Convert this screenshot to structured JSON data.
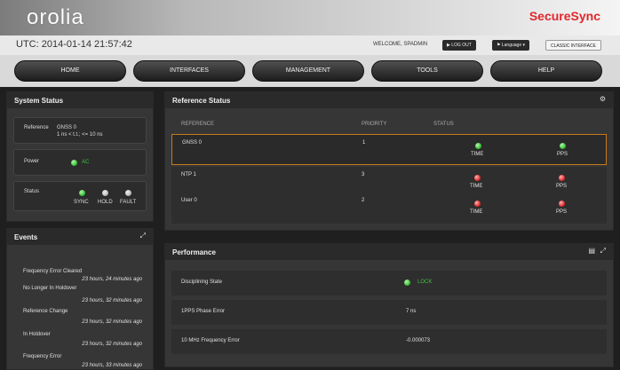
{
  "header": {
    "logo_text": "orolia",
    "product_name": "SecureSync"
  },
  "infobar": {
    "utc": "UTC: 2014-01-14 21:57:42",
    "welcome": "WELCOME, SPADMIN",
    "logout_label": "LOG OUT",
    "language_label": "Language",
    "classic_label": "CLASSIC INTERFACE"
  },
  "nav": {
    "items": [
      "HOME",
      "INTERFACES",
      "MANAGEMENT",
      "TOOLS",
      "HELP"
    ]
  },
  "system_status": {
    "title": "System Status",
    "reference_label": "Reference",
    "reference_value": "GNSS 0",
    "reference_sub": "1 ns < t.t.; <= 10 ns",
    "power_label": "Power",
    "power_value": "AC",
    "status_label": "Status",
    "indicators": [
      "SYNC",
      "HOLD",
      "FAULT"
    ],
    "indicator_states": [
      "green",
      "grey",
      "grey"
    ]
  },
  "events": {
    "title": "Events",
    "expand_icon": "expand-icon",
    "items": [
      {
        "text": "Frequency Error Cleared",
        "time": "23 hours, 24 minutes ago"
      },
      {
        "text": "No Longer In Holdover",
        "time": "23 hours, 32 minutes ago"
      },
      {
        "text": "Reference Change",
        "time": "23 hours, 32 minutes ago"
      },
      {
        "text": "In Holdover",
        "time": "23 hours, 32 minutes ago"
      },
      {
        "text": "Frequency Error",
        "time": "23 hours, 33 minutes ago"
      }
    ]
  },
  "reference_status": {
    "title": "Reference Status",
    "settings_icon": "gear-icon",
    "columns": [
      "REFERENCE",
      "PRIORITY",
      "STATUS"
    ],
    "time_label": "TIME",
    "pps_label": "PPS",
    "rows": [
      {
        "name": "GNSS 0",
        "priority": "1",
        "time": "green",
        "pps": "green"
      },
      {
        "name": "NTP 1",
        "priority": "3",
        "time": "red",
        "pps": "red"
      },
      {
        "name": "User 0",
        "priority": "2",
        "time": "red",
        "pps": "red"
      }
    ]
  },
  "performance": {
    "title": "Performance",
    "rows": [
      {
        "label": "Disciplining State",
        "value": "LOCK"
      },
      {
        "label": "1PPS Phase Error",
        "value": "7 ns"
      },
      {
        "label": "10 MHz Frequency Error",
        "value": "-0.000073"
      }
    ]
  },
  "colors": {
    "accent_red": "#e2262b",
    "selected_border": "#c7791b",
    "ok_green": "#3ec43a"
  }
}
